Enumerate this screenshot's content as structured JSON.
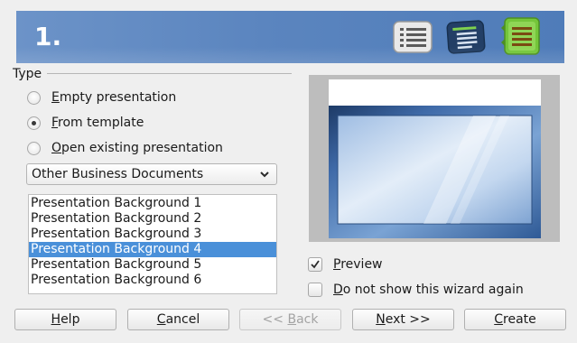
{
  "header": {
    "step": "1.",
    "icons": [
      "list-icon",
      "outline-icon",
      "notes-icon"
    ]
  },
  "type_group": {
    "label": "Type",
    "options": [
      {
        "label": "Empty presentation",
        "accesskey": "E",
        "rest": "mpty presentation",
        "checked": false
      },
      {
        "label": "From template",
        "accesskey": "F",
        "rest": "rom template",
        "checked": true
      },
      {
        "label": "Open existing presentation",
        "accesskey": "O",
        "rest": "pen existing presentation",
        "checked": false
      }
    ]
  },
  "category_select": {
    "value": "Other Business Documents"
  },
  "templates": {
    "items": [
      "Presentation Background 1",
      "Presentation Background 2",
      "Presentation Background 3",
      "Presentation Background 4",
      "Presentation Background 5",
      "Presentation Background 6"
    ],
    "selected_index": 3
  },
  "preview": {
    "label": "Preview",
    "accesskey": "P",
    "rest": "review",
    "checked": true
  },
  "dont_show": {
    "label": "Do not show this wizard again",
    "accesskey": "D",
    "rest": "o not show this wizard again",
    "checked": false
  },
  "buttons": {
    "help": {
      "label": "Help",
      "accesskey": "H",
      "rest": "elp"
    },
    "cancel": {
      "label": "Cancel",
      "accesskey": "C",
      "rest": "ancel"
    },
    "back": {
      "label": "<< Back",
      "pre": "<< ",
      "accesskey": "B",
      "rest": "ack",
      "disabled": true
    },
    "next": {
      "label": "Next >>",
      "accesskey": "N",
      "rest": "ext >>"
    },
    "create": {
      "label": "Create",
      "accesskey": "C",
      "rest": "reate"
    }
  },
  "colors": {
    "banner": "#5b85bf",
    "selection": "#4a90d9"
  }
}
